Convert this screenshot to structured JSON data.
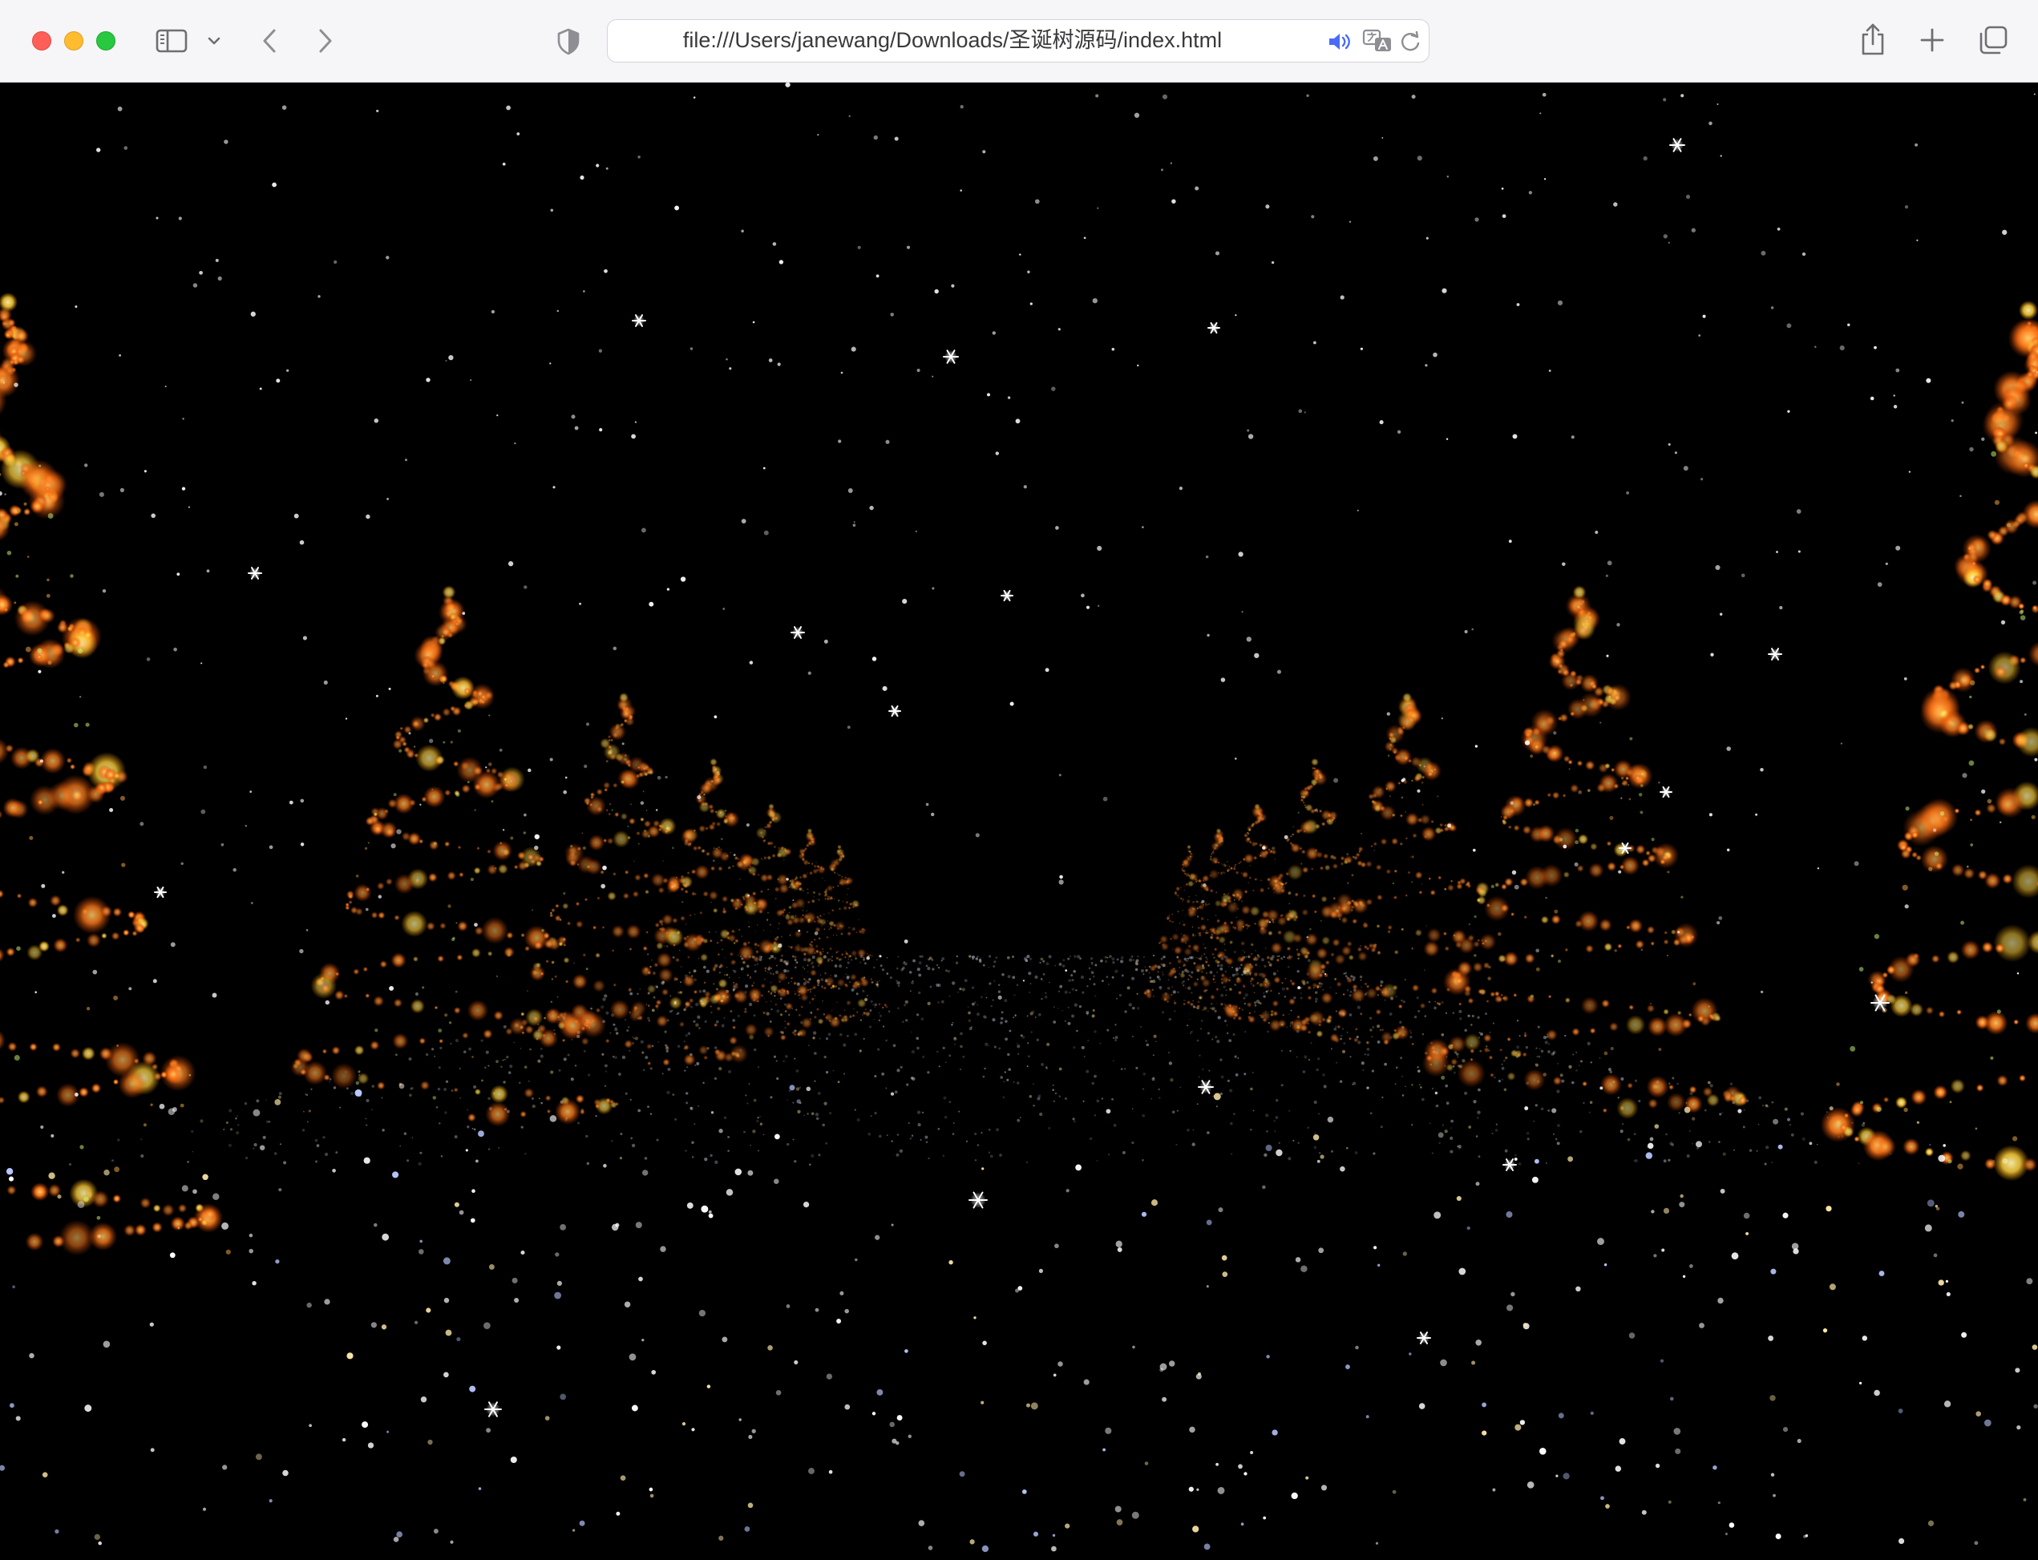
{
  "browser": {
    "url": "file:///Users/janewang/Downloads/圣诞树源码/index.html",
    "icons": {
      "sidebar": "sidebar-icon",
      "tab_dropdown": "chevron-down-icon",
      "back": "chevron-left-icon",
      "forward": "chevron-right-icon",
      "privacy": "shield-icon",
      "audio": "speaker-icon",
      "translate": "translate-icon",
      "reload": "reload-icon",
      "share": "share-icon",
      "new_tab": "plus-icon",
      "tab_overview": "tabs-overview-icon"
    },
    "colors": {
      "close": "#ff5f57",
      "minimize": "#febc2e",
      "zoom": "#28c840",
      "audio_accent": "#4a6cf7"
    }
  },
  "scene": {
    "background": "#000000",
    "tree_color": "#ff7a1a",
    "tree_highlight": "#ffd23a",
    "snow_color": "#ffffff",
    "trees": [
      {
        "side": "left",
        "depth": 0
      },
      {
        "side": "left",
        "depth": 1
      },
      {
        "side": "left",
        "depth": 2
      },
      {
        "side": "left",
        "depth": 3
      },
      {
        "side": "left",
        "depth": 4
      },
      {
        "side": "left",
        "depth": 5
      },
      {
        "side": "left",
        "depth": 6
      },
      {
        "side": "right",
        "depth": 0
      },
      {
        "side": "right",
        "depth": 1
      },
      {
        "side": "right",
        "depth": 2
      },
      {
        "side": "right",
        "depth": 3
      },
      {
        "side": "right",
        "depth": 4
      },
      {
        "side": "right",
        "depth": 5
      },
      {
        "side": "right",
        "depth": 6
      }
    ]
  }
}
